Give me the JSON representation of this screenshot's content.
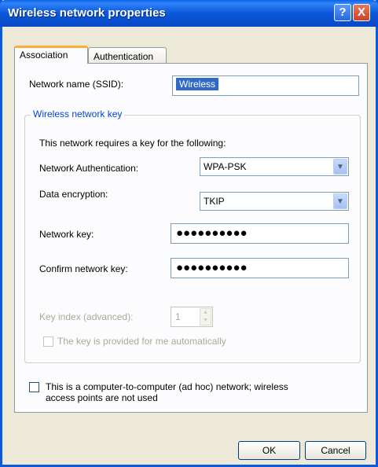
{
  "window": {
    "title": "Wireless network properties"
  },
  "tabs": [
    {
      "label": "Association",
      "active": true
    },
    {
      "label": "Authentication",
      "active": false
    }
  ],
  "ssid": {
    "label": "Network name (SSID):",
    "value": "Wireless"
  },
  "key_group": {
    "title": "Wireless network key",
    "description": "This network requires a key for the following:",
    "auth": {
      "label": "Network Authentication:",
      "value": "WPA-PSK"
    },
    "encryption": {
      "label": "Data encryption:",
      "value": "TKIP"
    },
    "network_key": {
      "label": "Network key:",
      "value": "●●●●●●●●●●"
    },
    "confirm_key": {
      "label": "Confirm network key:",
      "value": "●●●●●●●●●●"
    },
    "key_index": {
      "label": "Key index (advanced):",
      "value": "1"
    },
    "auto_key": {
      "label": "The key is provided for me automatically",
      "checked": false
    }
  },
  "adhoc": {
    "label_line1": "This is a computer-to-computer (ad hoc) network; wireless",
    "label_line2": "access points are not used",
    "checked": false
  },
  "buttons": {
    "ok": "OK",
    "cancel": "Cancel"
  },
  "icons": {
    "help": "?",
    "close": "X"
  },
  "colors": {
    "titlebar": "#0a58da",
    "face": "#ece9d8",
    "group_title": "#0046d5",
    "selection": "#316ac5"
  }
}
